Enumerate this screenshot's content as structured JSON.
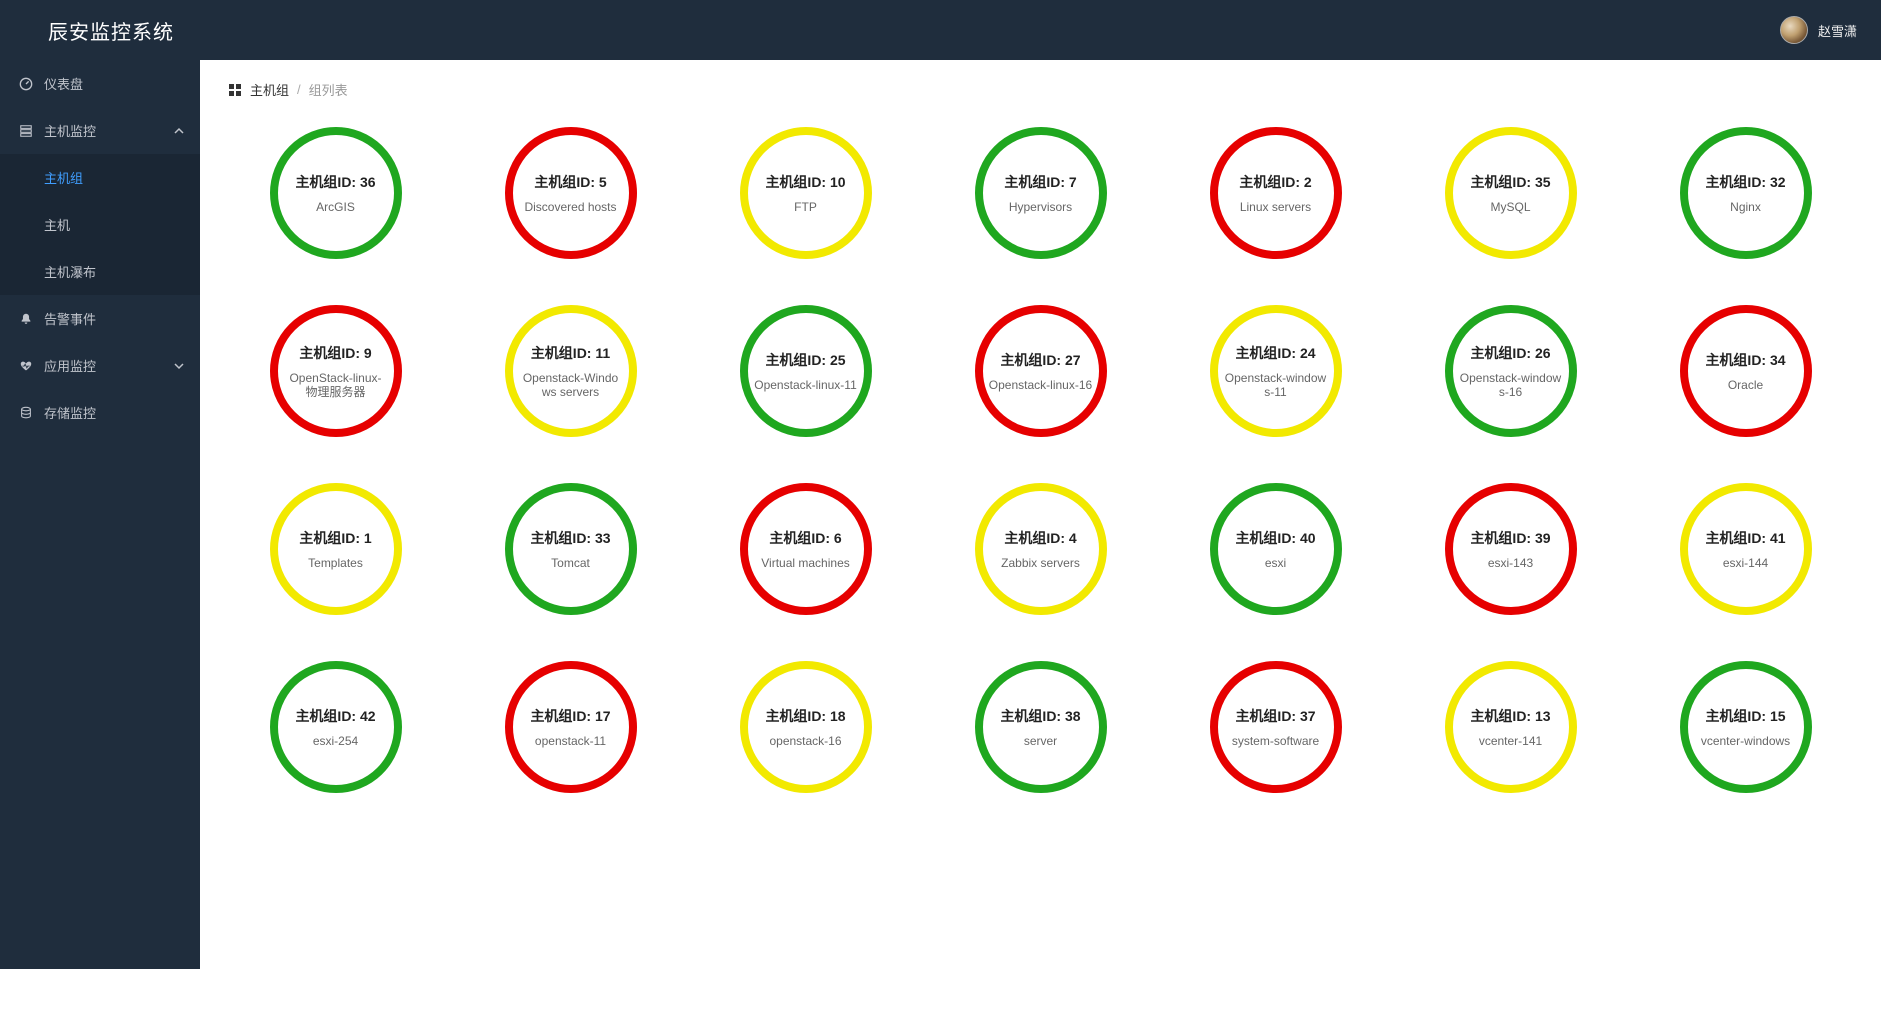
{
  "app": {
    "title": "辰安监控系统",
    "username": "赵雪潇"
  },
  "sidebar": {
    "items": [
      {
        "label": "仪表盘",
        "icon": "dashboard-icon",
        "hasChildren": false
      },
      {
        "label": "主机监控",
        "icon": "server-icon",
        "hasChildren": true,
        "expanded": true,
        "children": [
          {
            "label": "主机组",
            "active": true
          },
          {
            "label": "主机",
            "active": false
          },
          {
            "label": "主机瀑布",
            "active": false
          }
        ]
      },
      {
        "label": "告警事件",
        "icon": "bell-icon",
        "hasChildren": false
      },
      {
        "label": "应用监控",
        "icon": "heart-icon",
        "hasChildren": true,
        "expanded": false
      },
      {
        "label": "存储监控",
        "icon": "database-icon",
        "hasChildren": false
      }
    ]
  },
  "breadcrumb": {
    "root": "主机组",
    "current": "组列表"
  },
  "hostGroupLabelPrefix": "主机组ID: ",
  "colorMap": {
    "green": "#1fa71f",
    "red": "#e60000",
    "yellow": "#f2e900"
  },
  "hostGroups": [
    {
      "id": 36,
      "name": "ArcGIS",
      "status": "green"
    },
    {
      "id": 5,
      "name": "Discovered hosts",
      "status": "red"
    },
    {
      "id": 10,
      "name": "FTP",
      "status": "yellow"
    },
    {
      "id": 7,
      "name": "Hypervisors",
      "status": "green"
    },
    {
      "id": 2,
      "name": "Linux servers",
      "status": "red"
    },
    {
      "id": 35,
      "name": "MySQL",
      "status": "yellow"
    },
    {
      "id": 32,
      "name": "Nginx",
      "status": "green"
    },
    {
      "id": 9,
      "name": "OpenStack-linux-物理服务器",
      "status": "red"
    },
    {
      "id": 11,
      "name": "Openstack-Windows servers",
      "status": "yellow"
    },
    {
      "id": 25,
      "name": "Openstack-linux-11",
      "status": "green"
    },
    {
      "id": 27,
      "name": "Openstack-linux-16",
      "status": "red"
    },
    {
      "id": 24,
      "name": "Openstack-windows-11",
      "status": "yellow"
    },
    {
      "id": 26,
      "name": "Openstack-windows-16",
      "status": "green"
    },
    {
      "id": 34,
      "name": "Oracle",
      "status": "red"
    },
    {
      "id": 1,
      "name": "Templates",
      "status": "yellow"
    },
    {
      "id": 33,
      "name": "Tomcat",
      "status": "green"
    },
    {
      "id": 6,
      "name": "Virtual machines",
      "status": "red"
    },
    {
      "id": 4,
      "name": "Zabbix servers",
      "status": "yellow"
    },
    {
      "id": 40,
      "name": "esxi",
      "status": "green"
    },
    {
      "id": 39,
      "name": "esxi-143",
      "status": "red"
    },
    {
      "id": 41,
      "name": "esxi-144",
      "status": "yellow"
    },
    {
      "id": 42,
      "name": "esxi-254",
      "status": "green"
    },
    {
      "id": 17,
      "name": "openstack-11",
      "status": "red"
    },
    {
      "id": 18,
      "name": "openstack-16",
      "status": "yellow"
    },
    {
      "id": 38,
      "name": "server",
      "status": "green"
    },
    {
      "id": 37,
      "name": "system-software",
      "status": "red"
    },
    {
      "id": 13,
      "name": "vcenter-141",
      "status": "yellow"
    },
    {
      "id": 15,
      "name": "vcenter-windows",
      "status": "green"
    }
  ]
}
